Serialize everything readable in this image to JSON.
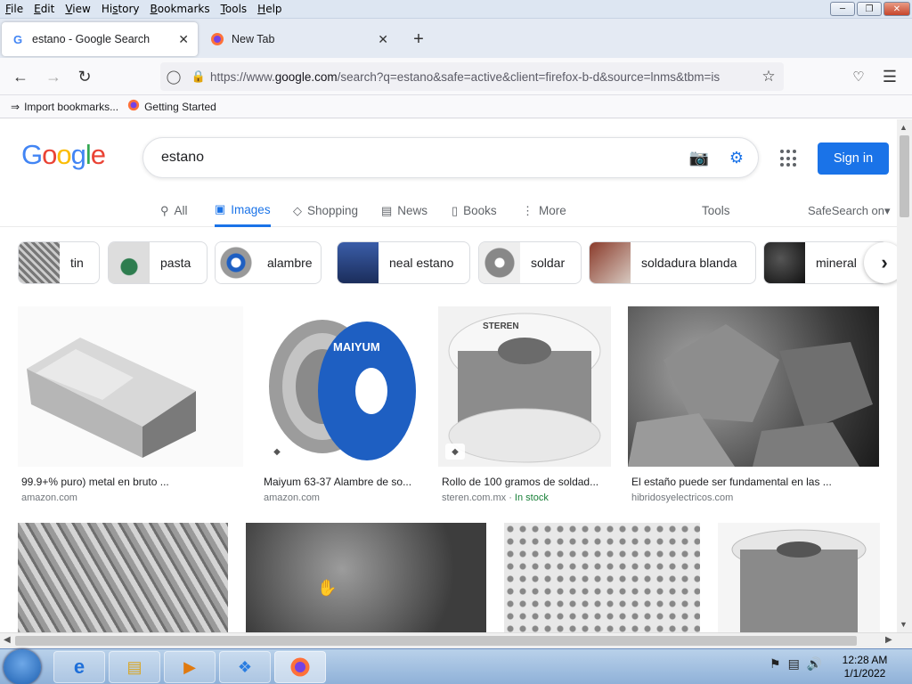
{
  "menu": [
    "File",
    "Edit",
    "View",
    "History",
    "Bookmarks",
    "Tools",
    "Help"
  ],
  "menu_access": [
    "F",
    "E",
    "V",
    "s",
    "B",
    "T",
    "H"
  ],
  "tabs": [
    {
      "label": "estano - Google Search",
      "favicon": "G"
    },
    {
      "label": "New Tab",
      "favicon": "firefox-icon"
    }
  ],
  "url": {
    "host_prefix": "https://www.",
    "host": "google.com",
    "path": "/search?q=estano&safe=active&client=firefox-b-d&source=lnms&tbm=is"
  },
  "bookmarks": [
    {
      "label": "Import bookmarks...",
      "icon": "import-icon"
    },
    {
      "label": "Getting Started",
      "icon": "firefox-icon"
    }
  ],
  "google": {
    "query": "estano",
    "signin": "Sign in",
    "tabs": [
      {
        "label": "All",
        "icon": "search-icon"
      },
      {
        "label": "Images",
        "icon": "image-icon"
      },
      {
        "label": "Shopping",
        "icon": "tag-icon"
      },
      {
        "label": "News",
        "icon": "news-icon"
      },
      {
        "label": "Books",
        "icon": "book-icon"
      },
      {
        "label": "More",
        "icon": "dots-icon"
      }
    ],
    "tools": "Tools",
    "safesearch": "SafeSearch on"
  },
  "chips": [
    "tin",
    "pasta",
    "alambre",
    "neal estano",
    "soldar",
    "soldadura blanda",
    "mineral"
  ],
  "results": [
    {
      "caption": "99.9+% puro) metal en bruto ...",
      "source": "amazon.com",
      "stock": ""
    },
    {
      "caption": "Maiyum 63-37 Alambre de so...",
      "source": "amazon.com",
      "stock": ""
    },
    {
      "caption": "Rollo de 100 gramos de soldad...",
      "source": "steren.com.mx",
      "stock": "In stock"
    },
    {
      "caption": "El estaño puede ser fundamental en las ...",
      "source": "hibridosyelectricos.com",
      "stock": ""
    },
    {
      "caption": "",
      "source": "",
      "stock": ""
    },
    {
      "caption": "",
      "source": "",
      "stock": ""
    },
    {
      "caption": "",
      "source": "",
      "stock": ""
    },
    {
      "caption": "",
      "source": "",
      "stock": ""
    }
  ],
  "image_text": {
    "spool1": "MAIYUM",
    "spool2": "STEREN"
  },
  "clock": {
    "time": "12:28 AM",
    "date": "1/1/2022"
  },
  "colors": {
    "accent": "#1a73e8",
    "stock": "#188038",
    "menubar": "#dde6f2"
  }
}
